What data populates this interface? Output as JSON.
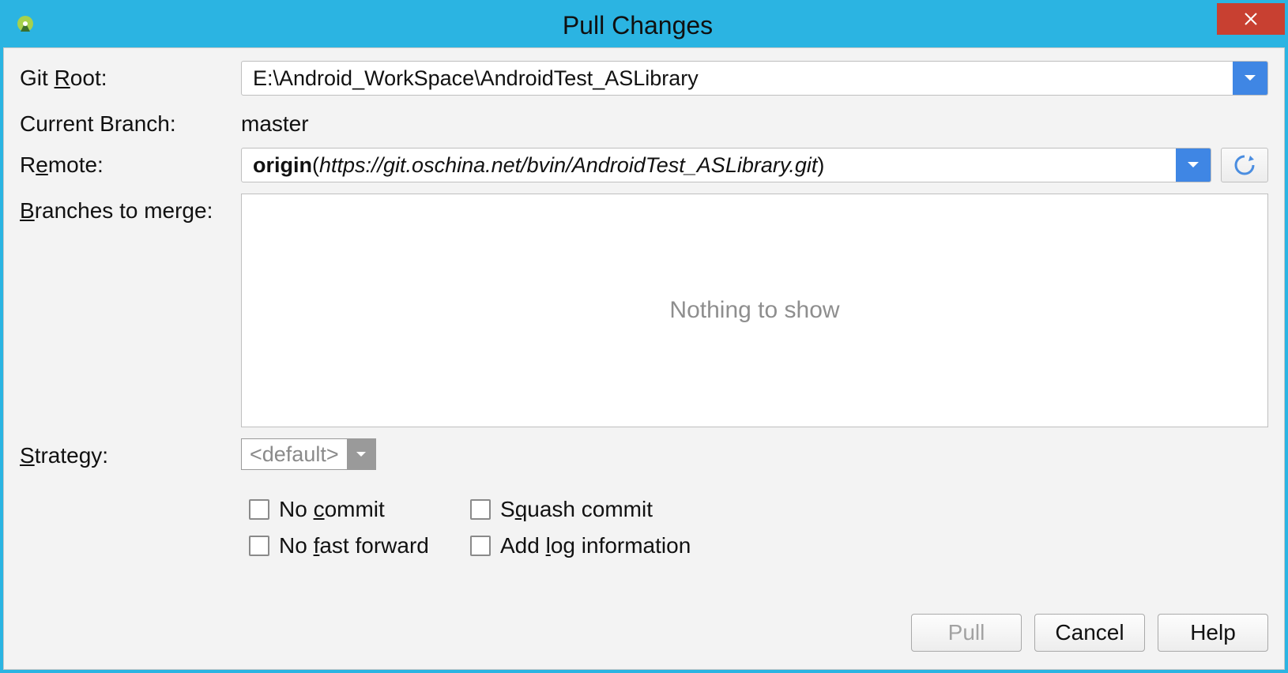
{
  "window": {
    "title": "Pull Changes"
  },
  "labels": {
    "git_root": "Git Root:",
    "current_branch": "Current Branch:",
    "remote": "Remote:",
    "branches_to_merge": "Branches to merge:",
    "strategy": "Strategy:"
  },
  "values": {
    "git_root_path": "E:\\Android_WorkSpace\\AndroidTest_ASLibrary",
    "current_branch": "master",
    "remote_name": "origin",
    "remote_url": "https://git.oschina.net/bvin/AndroidTest_ASLibrary.git",
    "branches_placeholder": "Nothing to show",
    "strategy_value": "<default>"
  },
  "checkboxes": {
    "no_commit": "No commit",
    "squash_commit": "Squash commit",
    "no_fast_forward": "No fast forward",
    "add_log_info": "Add log information"
  },
  "buttons": {
    "pull": "Pull",
    "cancel": "Cancel",
    "help": "Help"
  }
}
